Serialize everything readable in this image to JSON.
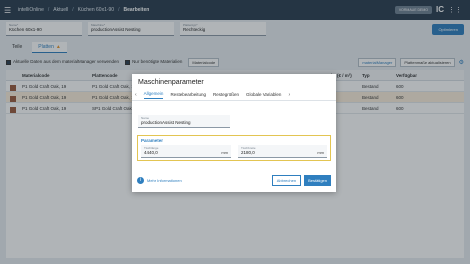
{
  "topbar": {
    "menu_icon": "menu-icon",
    "crumbs": [
      "intelliOnline",
      "Aktuell",
      "Küchen 60x1-90",
      "Bearbeiten"
    ],
    "pill": "VORMAUE DEMO",
    "logo": "IC"
  },
  "form": {
    "name_label": "Name*",
    "name_value": "Küchen 60x1-90",
    "maschine_label": "Maschine*",
    "maschine_value": "productionAssist Nesting",
    "plattentyp_label": "Plattentyp*",
    "plattentyp_value": "Rechteckig",
    "optimize_button": "Optimieren"
  },
  "tabs": {
    "teile": "Teile",
    "platten": "Platten"
  },
  "toolbar": {
    "use_material_manager": "Aktuelle Daten aus dem materialManager verwenden",
    "only_needed": "Nur benötigte Materialien",
    "materialcode_placeholder": "Materialcode",
    "material_manager_button": "materialManager",
    "add_plate_button": "Plattenmaße aktualisieren"
  },
  "table": {
    "headers": [
      "Materialcode",
      "Plattencode",
      "Stärke (€ / m²)",
      "Typ",
      "Verfügbar"
    ],
    "rows": [
      [
        "P1 Gold Craft Oak, 19",
        "P1 Gold Craft Oak, 19",
        "",
        "Bestand",
        "600"
      ],
      [
        "P1 Gold Craft Oak, 19",
        "P1 Gold Craft Oak, 19",
        "",
        "Bestand",
        "600"
      ],
      [
        "P1 Gold Craft Oak, 19",
        "SP1 Gold Craft Oak, 19",
        "",
        "Bestand",
        "600"
      ]
    ]
  },
  "dialog": {
    "title": "Maschinenparameter",
    "tabs": [
      "Allgemein",
      "Restebearbeitung",
      "Restegrößen",
      "Globale Variablen"
    ],
    "name_label": "Name",
    "name_value": "productionAssist Nesting",
    "params_title": "Parameter",
    "tischlaenge_label": "Tischlänge",
    "tischlaenge_value": "4440,0",
    "tischbreite_label": "Tischbreite",
    "tischbreite_value": "2180,0",
    "unit": "mm",
    "more_info": "Mehr Informationen",
    "cancel": "Abbrechen",
    "confirm": "Bestätigen"
  }
}
